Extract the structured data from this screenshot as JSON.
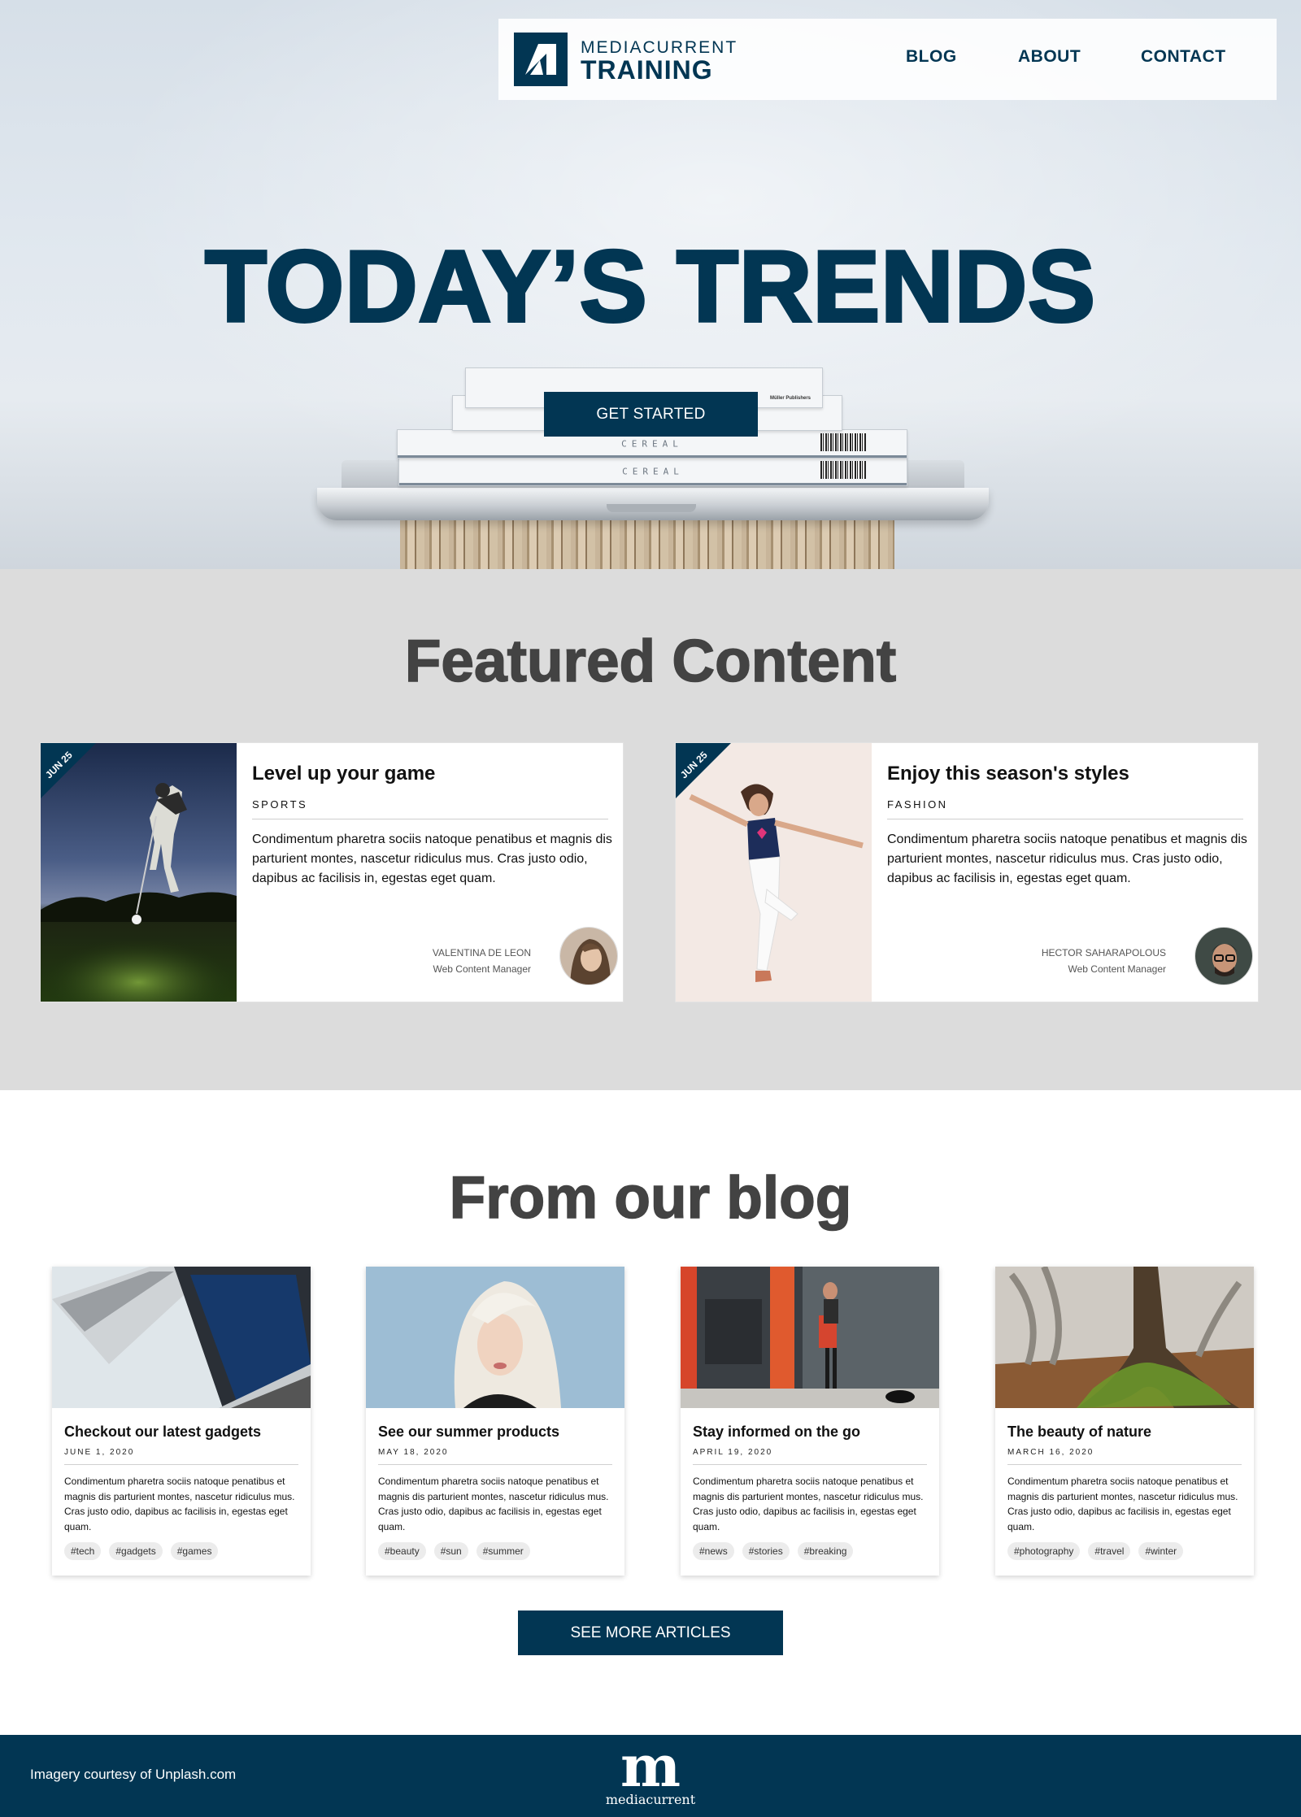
{
  "header": {
    "logo_top": "MEDIACURRENT",
    "logo_bottom": "TRAINING",
    "nav": [
      "BLOG",
      "ABOUT",
      "CONTACT"
    ]
  },
  "hero": {
    "title": "TODAY’S TRENDS",
    "cta": "GET STARTED",
    "book_spine": "CEREAL",
    "book_publisher": "Müller Publishers"
  },
  "featured": {
    "title": "Featured Content",
    "cards": [
      {
        "date": "JUN 25",
        "title": "Level up your game",
        "category": "SPORTS",
        "body": "Condimentum pharetra sociis natoque penatibus et magnis dis parturient montes, nascetur ridiculus mus. Cras justo odio, dapibus ac facilisis in, egestas eget quam.",
        "author": "VALENTINA DE LEON",
        "role": "Web Content Manager",
        "image": "golfer-night-photo",
        "avatar": "woman-avatar"
      },
      {
        "date": "JUN 25",
        "title": "Enjoy this season's styles",
        "category": "FASHION",
        "body": "Condimentum pharetra sociis natoque penatibus et magnis dis parturient montes, nascetur ridiculus mus. Cras justo odio, dapibus ac facilisis in, egestas eget quam.",
        "author": "HECTOR SAHARAPOLOUS",
        "role": "Web Content Manager",
        "image": "dancing-woman-photo",
        "avatar": "man-glasses-avatar"
      }
    ]
  },
  "blog": {
    "title": "From our blog",
    "cards": [
      {
        "title": "Checkout our latest gadgets",
        "date": "JUNE 1, 2020",
        "tags": [
          "#tech",
          "#gadgets",
          "#games"
        ],
        "image": "laptops-photo"
      },
      {
        "title": "See our summer products",
        "date": "MAY 18, 2020",
        "tags": [
          "#beauty",
          "#sun",
          "#summer"
        ],
        "image": "portrait-photo"
      },
      {
        "title": "Stay informed on the go",
        "date": "APRIL 19, 2020",
        "tags": [
          "#news",
          "#stories",
          "#breaking"
        ],
        "image": "street-photo"
      },
      {
        "title": "The beauty of nature",
        "date": "MARCH 16, 2020",
        "tags": [
          "#photography",
          "#travel",
          "#winter"
        ],
        "image": "forest-tree-photo"
      }
    ],
    "body": "Condimentum pharetra sociis natoque penatibus et magnis dis parturient montes, nascetur ridiculus mus. Cras justo odio, dapibus ac facilisis in, egestas eget quam.",
    "more": "SEE MORE ARTICLES"
  },
  "footer": {
    "credit": "Imagery courtesy of Unplash.com",
    "logo_mark": "m",
    "logo_text": "mediacurrent"
  },
  "colors": {
    "brand": "#023653",
    "section_gray": "#dcdcdc",
    "heading_gray": "#434343"
  }
}
